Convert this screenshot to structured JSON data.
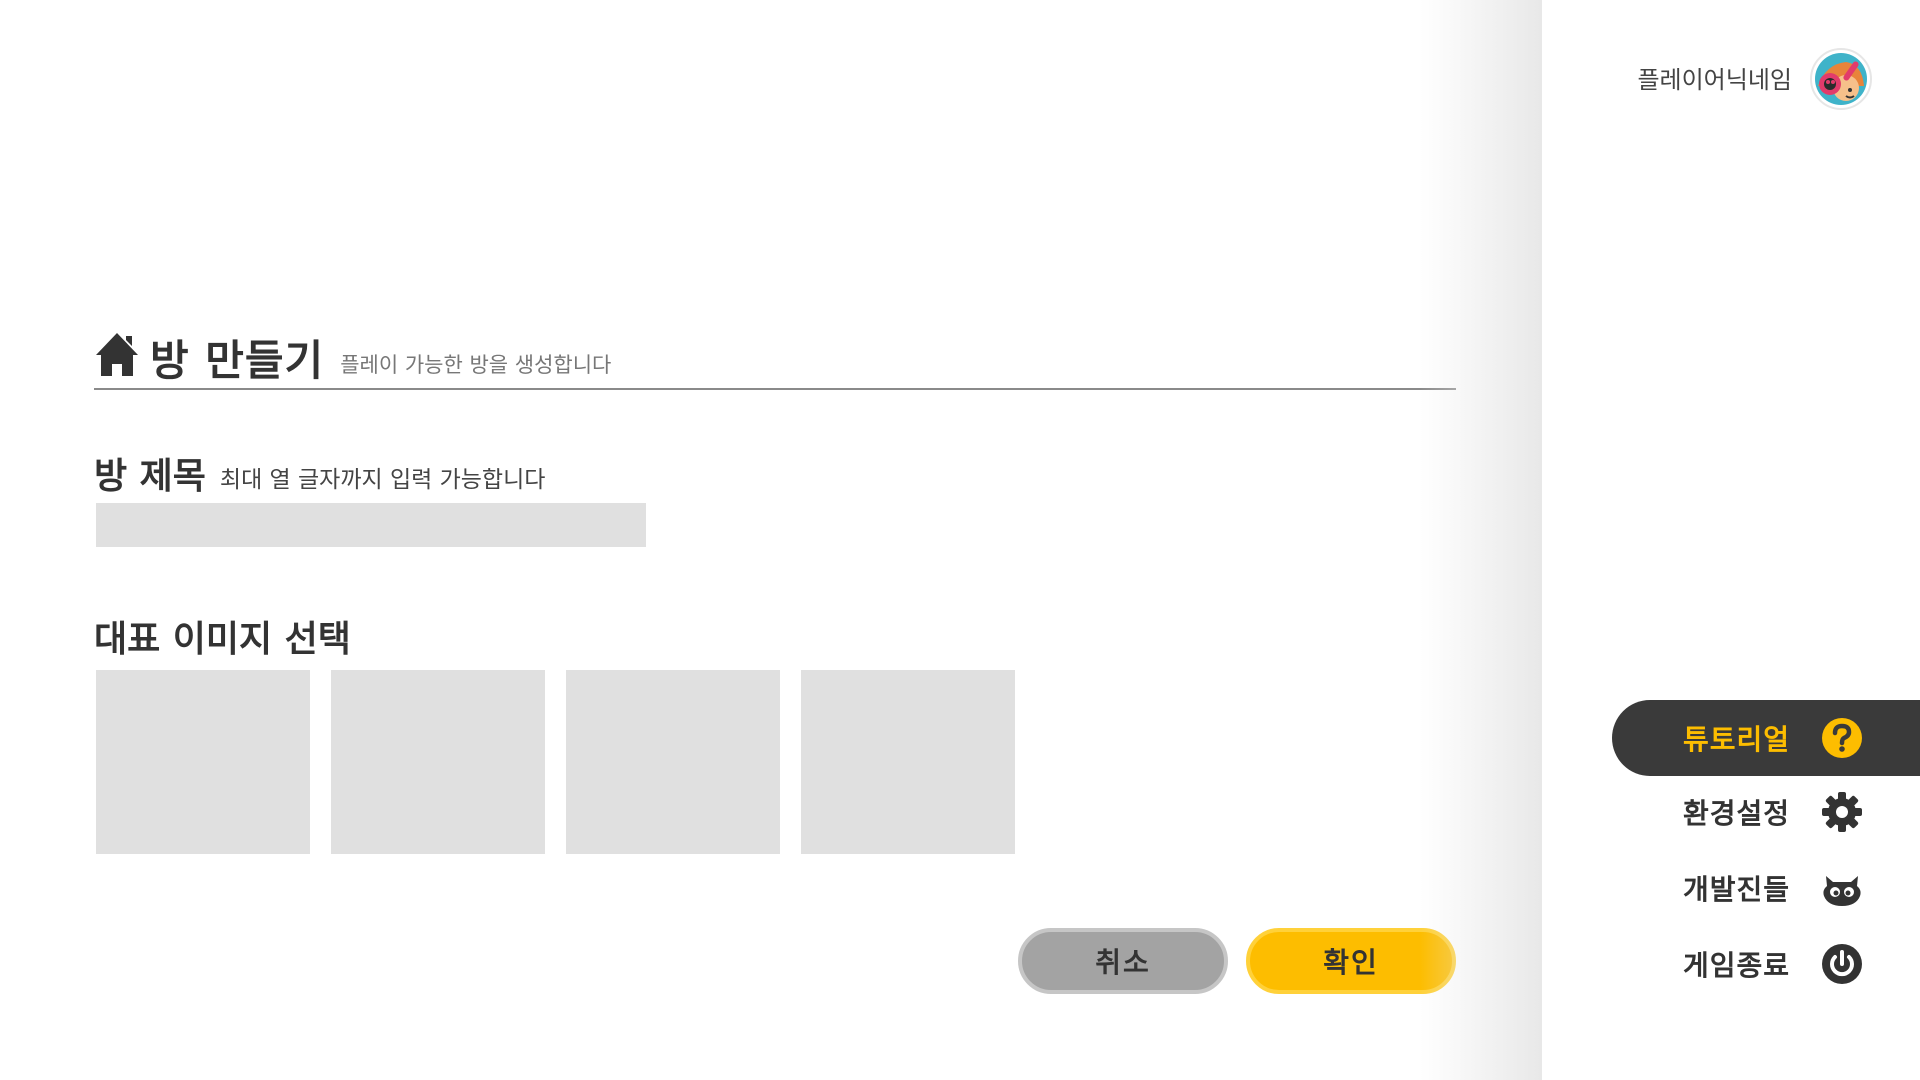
{
  "create_room": {
    "title": "방 만들기",
    "subtitle": "플레이 가능한 방을 생성합니다"
  },
  "room_title": {
    "label": "방 제목",
    "hint": "최대 열 글자까지 입력 가능합니다",
    "value": ""
  },
  "image_select": {
    "label": "대표 이미지 선택",
    "options": [
      "",
      "",
      "",
      ""
    ]
  },
  "buttons": {
    "cancel": "취소",
    "confirm": "확인"
  },
  "player": {
    "nickname": "플레이어닉네임"
  },
  "menu": {
    "items": [
      {
        "label": "튜토리얼",
        "icon": "help-icon",
        "active": true
      },
      {
        "label": "환경설정",
        "icon": "gear-icon",
        "active": false
      },
      {
        "label": "개발진들",
        "icon": "developers-mascot-icon",
        "active": false
      },
      {
        "label": "게임종료",
        "icon": "power-icon",
        "active": false
      }
    ]
  },
  "colors": {
    "accent": "#fdbd00",
    "dark": "#3a3a3a",
    "placeholder": "#e0e0e0",
    "cancel": "#a3a3a3"
  }
}
